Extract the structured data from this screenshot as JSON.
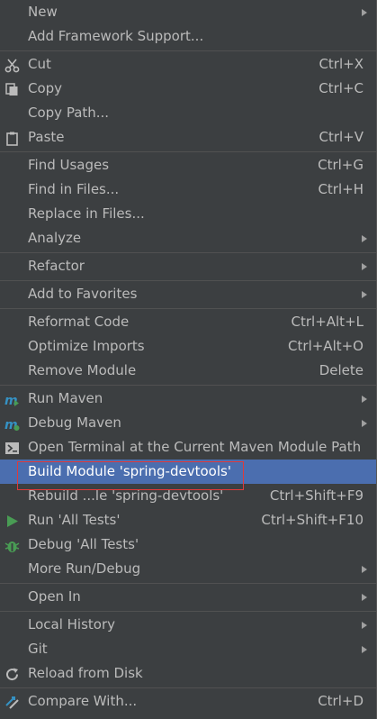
{
  "menu": {
    "items": [
      {
        "label": "New",
        "shortcut": "",
        "submenu": true,
        "icon": ""
      },
      {
        "label": "Add Framework Support...",
        "shortcut": "",
        "submenu": false,
        "icon": ""
      },
      {
        "sep": true
      },
      {
        "label": "Cut",
        "shortcut": "Ctrl+X",
        "submenu": false,
        "icon": "scissors-icon"
      },
      {
        "label": "Copy",
        "shortcut": "Ctrl+C",
        "submenu": false,
        "icon": "copy-icon"
      },
      {
        "label": "Copy Path...",
        "shortcut": "",
        "submenu": false,
        "icon": ""
      },
      {
        "label": "Paste",
        "shortcut": "Ctrl+V",
        "submenu": false,
        "icon": "clipboard-icon"
      },
      {
        "sep": true
      },
      {
        "label": "Find Usages",
        "shortcut": "Ctrl+G",
        "submenu": false,
        "icon": ""
      },
      {
        "label": "Find in Files...",
        "shortcut": "Ctrl+H",
        "submenu": false,
        "icon": ""
      },
      {
        "label": "Replace in Files...",
        "shortcut": "",
        "submenu": false,
        "icon": ""
      },
      {
        "label": "Analyze",
        "shortcut": "",
        "submenu": true,
        "icon": ""
      },
      {
        "sep": true
      },
      {
        "label": "Refactor",
        "shortcut": "",
        "submenu": true,
        "icon": ""
      },
      {
        "sep": true
      },
      {
        "label": "Add to Favorites",
        "shortcut": "",
        "submenu": true,
        "icon": ""
      },
      {
        "sep": true
      },
      {
        "label": "Reformat Code",
        "shortcut": "Ctrl+Alt+L",
        "submenu": false,
        "icon": ""
      },
      {
        "label": "Optimize Imports",
        "shortcut": "Ctrl+Alt+O",
        "submenu": false,
        "icon": ""
      },
      {
        "label": "Remove Module",
        "shortcut": "Delete",
        "submenu": false,
        "icon": ""
      },
      {
        "sep": true
      },
      {
        "label": "Run Maven",
        "shortcut": "",
        "submenu": true,
        "icon": "maven-run-icon"
      },
      {
        "label": "Debug Maven",
        "shortcut": "",
        "submenu": true,
        "icon": "maven-debug-icon"
      },
      {
        "label": "Open Terminal at the Current Maven Module Path",
        "shortcut": "",
        "submenu": false,
        "icon": "terminal-icon"
      },
      {
        "label": "Build Module 'spring-devtools'",
        "shortcut": "",
        "submenu": false,
        "icon": "",
        "selected": true
      },
      {
        "label": "Rebuild ...le 'spring-devtools'",
        "shortcut": "Ctrl+Shift+F9",
        "submenu": false,
        "icon": ""
      },
      {
        "label": "Run 'All Tests'",
        "shortcut": "Ctrl+Shift+F10",
        "submenu": false,
        "icon": "run-icon"
      },
      {
        "label": "Debug 'All Tests'",
        "shortcut": "",
        "submenu": false,
        "icon": "debug-icon"
      },
      {
        "label": "More Run/Debug",
        "shortcut": "",
        "submenu": true,
        "icon": ""
      },
      {
        "sep": true
      },
      {
        "label": "Open In",
        "shortcut": "",
        "submenu": true,
        "icon": ""
      },
      {
        "sep": true
      },
      {
        "label": "Local History",
        "shortcut": "",
        "submenu": true,
        "icon": ""
      },
      {
        "label": "Git",
        "shortcut": "",
        "submenu": true,
        "icon": ""
      },
      {
        "label": "Reload from Disk",
        "shortcut": "",
        "submenu": false,
        "icon": "reload-icon"
      },
      {
        "sep": true
      },
      {
        "label": "Compare With...",
        "shortcut": "Ctrl+D",
        "submenu": false,
        "icon": "compare-icon"
      }
    ]
  }
}
